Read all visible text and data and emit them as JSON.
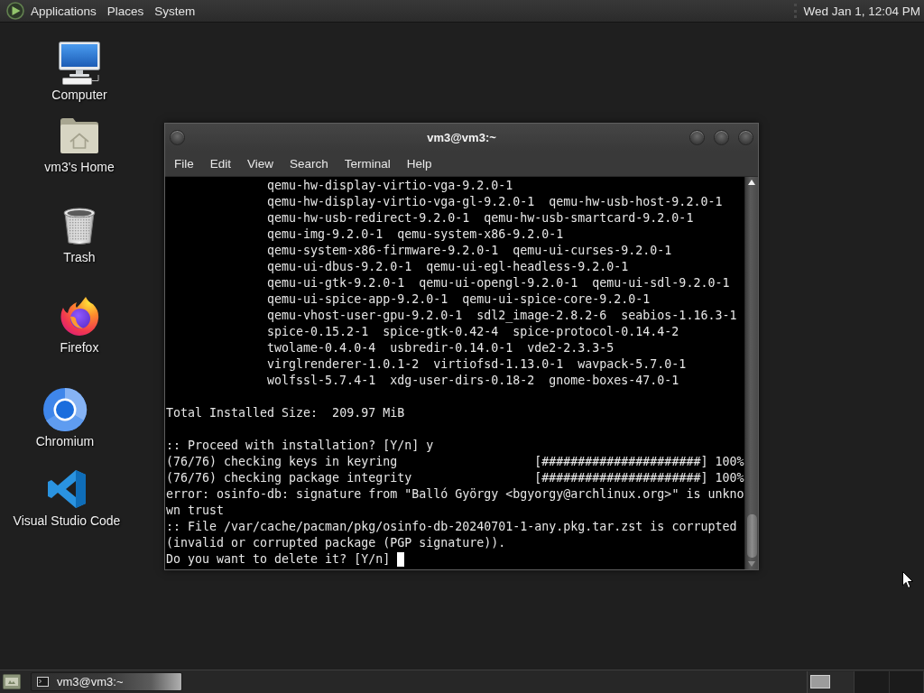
{
  "top_panel": {
    "menus": [
      "Applications",
      "Places",
      "System"
    ],
    "clock": "Wed Jan 1, 12:04 PM"
  },
  "desktop_icons": [
    {
      "label": "Computer"
    },
    {
      "label": "vm3's Home"
    },
    {
      "label": "Trash"
    },
    {
      "label": "Firefox"
    },
    {
      "label": "Chromium"
    },
    {
      "label": "Visual Studio Code"
    }
  ],
  "terminal_window": {
    "title": "vm3@vm3:~",
    "menus": [
      "File",
      "Edit",
      "View",
      "Search",
      "Terminal",
      "Help"
    ],
    "blocks": [
      {
        "indented": true,
        "lines": [
          "qemu-hw-display-virtio-vga-9.2.0-1",
          "qemu-hw-display-virtio-vga-gl-9.2.0-1  qemu-hw-usb-host-9.2.0-1",
          "qemu-hw-usb-redirect-9.2.0-1  qemu-hw-usb-smartcard-9.2.0-1",
          "qemu-img-9.2.0-1  qemu-system-x86-9.2.0-1",
          "qemu-system-x86-firmware-9.2.0-1  qemu-ui-curses-9.2.0-1",
          "qemu-ui-dbus-9.2.0-1  qemu-ui-egl-headless-9.2.0-1",
          "qemu-ui-gtk-9.2.0-1  qemu-ui-opengl-9.2.0-1  qemu-ui-sdl-9.2.0-1",
          "qemu-ui-spice-app-9.2.0-1  qemu-ui-spice-core-9.2.0-1",
          "qemu-vhost-user-gpu-9.2.0-1  sdl2_image-2.8.2-6  seabios-1.16.3-1",
          "spice-0.15.2-1  spice-gtk-0.42-4  spice-protocol-0.14.4-2",
          "twolame-0.4.0-4  usbredir-0.14.0-1  vde2-2.3.3-5",
          "virglrenderer-1.0.1-2  virtiofsd-1.13.0-1  wavpack-5.7.0-1",
          "wolfssl-5.7.4-1  xdg-user-dirs-0.18-2  gnome-boxes-47.0-1"
        ]
      },
      {
        "indented": false,
        "lines": [
          "Total Installed Size:  209.97 MiB"
        ]
      },
      {
        "indented": false,
        "lines": [
          ":: Proceed with installation? [Y/n] y",
          "(76/76) checking keys in keyring                   [######################] 100%",
          "(76/76) checking package integrity                 [######################] 100%",
          "error: osinfo-db: signature from \"Balló György <bgyorgy@archlinux.org>\" is unkno",
          "wn trust",
          ":: File /var/cache/pacman/pkg/osinfo-db-20240701-1-any.pkg.tar.zst is corrupted",
          "(invalid or corrupted package (PGP signature)).",
          "Do you want to delete it? [Y/n]"
        ]
      }
    ],
    "cursor": true
  },
  "taskbar": {
    "tasks": [
      {
        "label": "vm3@vm3:~",
        "selected": true
      }
    ]
  }
}
